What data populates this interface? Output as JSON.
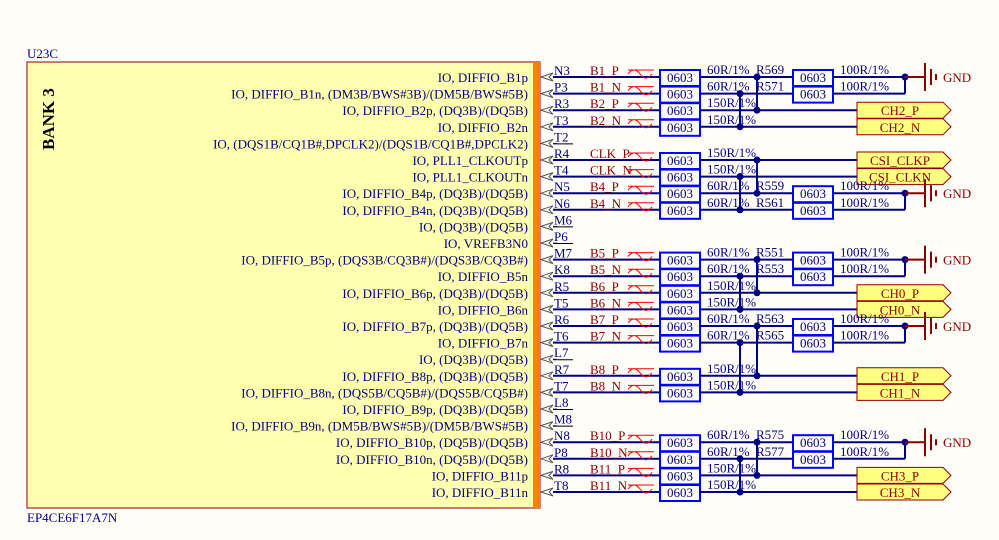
{
  "part": {
    "ref": "U23C",
    "bank": "BANK 3",
    "device": "EP4CE6F17A7N"
  },
  "rows": [
    {
      "pin": "N3",
      "label": "IO, DIFFIO_B1p",
      "net": "B1_P"
    },
    {
      "pin": "P3",
      "label": "IO, DIFFIO_B1n, (DM3B/BWS#3B)/(DM5B/BWS#5B)",
      "net": "B1_N"
    },
    {
      "pin": "R3",
      "label": "IO, DIFFIO_B2p, (DQ3B)/(DQ5B)",
      "net": "B2_P"
    },
    {
      "pin": "T3",
      "label": "IO, DIFFIO_B2n",
      "net": "B2_N"
    },
    {
      "pin": "T2",
      "label": "IO, (DQS1B/CQ1B#,DPCLK2)/(DQS1B/CQ1B#,DPCLK2)"
    },
    {
      "pin": "R4",
      "label": "IO, PLL1_CLKOUTp",
      "net": "CLK_P"
    },
    {
      "pin": "T4",
      "label": "IO, PLL1_CLKOUTn",
      "net": "CLK_N"
    },
    {
      "pin": "N5",
      "label": "IO, DIFFIO_B4p, (DQ3B)/(DQ5B)",
      "net": "B4_P"
    },
    {
      "pin": "N6",
      "label": "IO, DIFFIO_B4n, (DQ3B)/(DQ5B)",
      "net": "B4_N"
    },
    {
      "pin": "M6",
      "label": "IO, (DQ3B)/(DQ5B)"
    },
    {
      "pin": "P6",
      "label": "IO, VREFB3N0"
    },
    {
      "pin": "M7",
      "label": "IO, DIFFIO_B5p, (DQS3B/CQ3B#)/(DQS3B/CQ3B#)",
      "net": "B5_P"
    },
    {
      "pin": "K8",
      "label": "IO, DIFFIO_B5n",
      "net": "B5_N"
    },
    {
      "pin": "R5",
      "label": "IO, DIFFIO_B6p, (DQ3B)/(DQ5B)",
      "net": "B6_P"
    },
    {
      "pin": "T5",
      "label": "IO, DIFFIO_B6n",
      "net": "B6_N"
    },
    {
      "pin": "R6",
      "label": "IO, DIFFIO_B7p, (DQ3B)/(DQ5B)",
      "net": "B7_P"
    },
    {
      "pin": "T6",
      "label": "IO, DIFFIO_B7n",
      "net": "B7_N"
    },
    {
      "pin": "L7",
      "label": "IO, (DQ3B)/(DQ5B)"
    },
    {
      "pin": "R7",
      "label": "IO, DIFFIO_B8p, (DQ3B)/(DQ5B)",
      "net": "B8_P"
    },
    {
      "pin": "T7",
      "label": "IO, DIFFIO_B8n, (DQS5B/CQ5B#)/(DQS5B/CQ5B#)",
      "net": "B8_N"
    },
    {
      "pin": "L8",
      "label": "IO, DIFFIO_B9p, (DQ3B)/(DQ5B)"
    },
    {
      "pin": "M8",
      "label": "IO, DIFFIO_B9n, (DM5B/BWS#5B)/(DM5B/BWS#5B)"
    },
    {
      "pin": "N8",
      "label": "IO, DIFFIO_B10p, (DQ5B)/(DQ5B)",
      "net": "B10_P"
    },
    {
      "pin": "P8",
      "label": "IO, DIFFIO_B10n, (DQ5B)/(DQ5B)",
      "net": "B10_N"
    },
    {
      "pin": "R8",
      "label": "IO, DIFFIO_B11p",
      "net": "B11_P"
    },
    {
      "pin": "T8",
      "label": "IO, DIFFIO_B11n",
      "net": "B11_N"
    }
  ],
  "groups": [
    {
      "rows": [
        0,
        1
      ],
      "type": "term",
      "value": "60R/1%",
      "refs": [
        "R569",
        "R571"
      ],
      "term_value": "100R/1%",
      "gnd": "GND"
    },
    {
      "rows": [
        2,
        3
      ],
      "type": "port",
      "value": "150R/1%",
      "ports": [
        "CH2_P",
        "CH2_N"
      ]
    },
    {
      "rows": [
        5,
        6
      ],
      "type": "port",
      "value": "150R/1%",
      "ports": [
        "CSI_CLKP",
        "CSI_CLKN"
      ]
    },
    {
      "rows": [
        7,
        8
      ],
      "type": "term",
      "value": "60R/1%",
      "refs": [
        "R559",
        "R561"
      ],
      "term_value": "100R/1%",
      "gnd": "GND"
    },
    {
      "rows": [
        11,
        12
      ],
      "type": "term",
      "value": "60R/1%",
      "refs": [
        "R551",
        "R553"
      ],
      "term_value": "100R/1%",
      "gnd": "GND"
    },
    {
      "rows": [
        13,
        14
      ],
      "type": "port",
      "value": "150R/1%",
      "ports": [
        "CH0_P",
        "CH0_N"
      ]
    },
    {
      "rows": [
        15,
        16
      ],
      "type": "term",
      "value": "60R/1%",
      "refs": [
        "R563",
        "R565"
      ],
      "term_value": "100R/1%",
      "gnd": "GND"
    },
    {
      "rows": [
        18,
        19
      ],
      "type": "port",
      "value": "150R/1%",
      "ports": [
        "CH1_P",
        "CH1_N"
      ]
    },
    {
      "rows": [
        22,
        23
      ],
      "type": "term",
      "value": "60R/1%",
      "refs": [
        "R575",
        "R577"
      ],
      "term_value": "100R/1%",
      "gnd": "GND"
    },
    {
      "rows": [
        24,
        25
      ],
      "type": "port",
      "value": "150R/1%",
      "ports": [
        "CH3_P",
        "CH3_N"
      ]
    }
  ],
  "package": "0603",
  "colors": {
    "wire": "#000080",
    "part": "#8b0000",
    "box": "#0000ff",
    "port_fill": "#ffff80",
    "bank_strip": "#ff8000"
  }
}
